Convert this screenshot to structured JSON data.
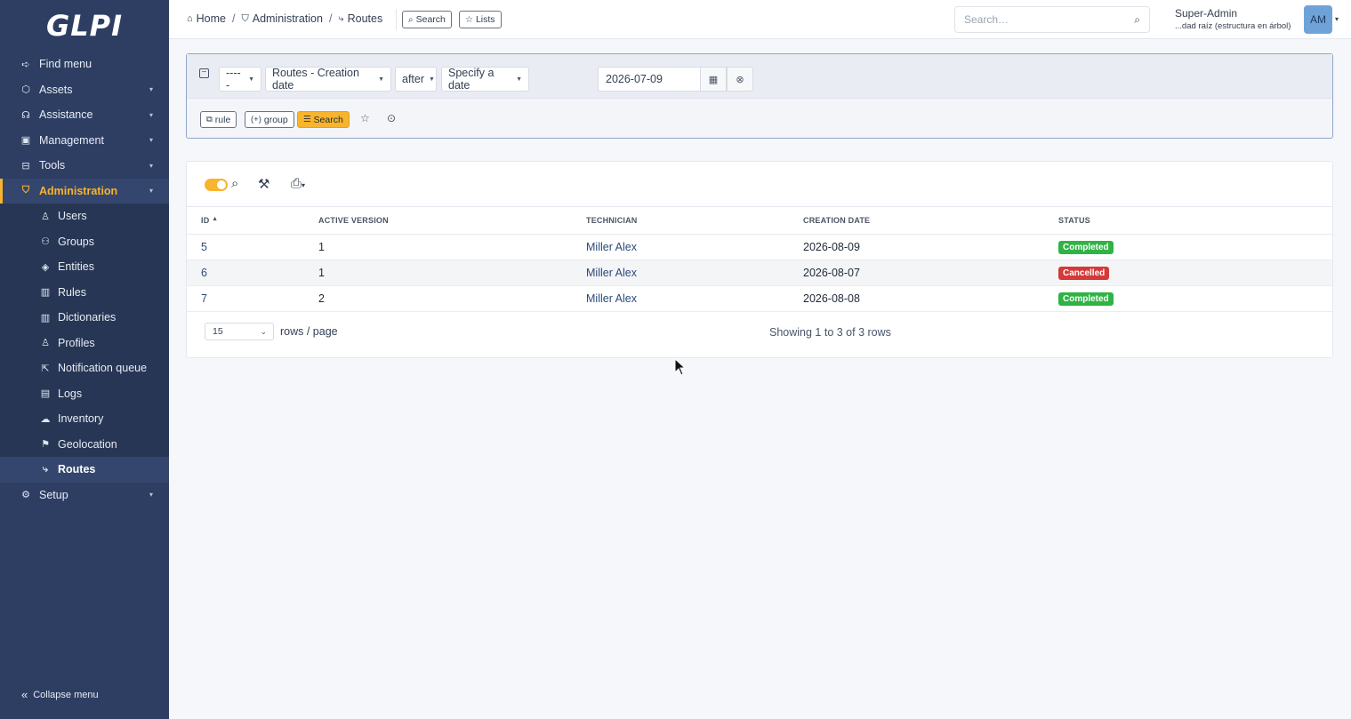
{
  "app": {
    "logo": "GLPI"
  },
  "sidebar": {
    "items": [
      {
        "label": "Find menu",
        "icon": "arrow-right-icon",
        "glyph": "➪",
        "chevron": false
      },
      {
        "label": "Assets",
        "icon": "box-icon",
        "glyph": "⬡",
        "chevron": true
      },
      {
        "label": "Assistance",
        "icon": "headset-icon",
        "glyph": "☊",
        "chevron": true
      },
      {
        "label": "Management",
        "icon": "wallet-icon",
        "glyph": "▣",
        "chevron": true
      },
      {
        "label": "Tools",
        "icon": "briefcase-icon",
        "glyph": "⊟",
        "chevron": true
      },
      {
        "label": "Administration",
        "icon": "shield-icon",
        "glyph": "⛉",
        "chevron": true,
        "active": true
      }
    ],
    "subitems": [
      {
        "label": "Users",
        "icon": "user-icon",
        "glyph": "♙"
      },
      {
        "label": "Groups",
        "icon": "users-icon",
        "glyph": "⚇"
      },
      {
        "label": "Entities",
        "icon": "layers-icon",
        "glyph": "◈"
      },
      {
        "label": "Rules",
        "icon": "book-icon",
        "glyph": "▥"
      },
      {
        "label": "Dictionaries",
        "icon": "book-icon",
        "glyph": "▥"
      },
      {
        "label": "Profiles",
        "icon": "user-check-icon",
        "glyph": "♙"
      },
      {
        "label": "Notification queue",
        "icon": "mail-forward-icon",
        "glyph": "⇱"
      },
      {
        "label": "Logs",
        "icon": "news-icon",
        "glyph": "▤"
      },
      {
        "label": "Inventory",
        "icon": "cloud-download-icon",
        "glyph": "☁"
      },
      {
        "label": "Geolocation",
        "icon": "map-route-icon",
        "glyph": "⚑"
      },
      {
        "label": "Routes",
        "icon": "route-icon",
        "glyph": "⤷",
        "current": true
      }
    ],
    "setup": {
      "label": "Setup",
      "icon": "gear-icon",
      "glyph": "⚙"
    },
    "collapse_label": "Collapse menu"
  },
  "header": {
    "breadcrumb": [
      {
        "label": "Home",
        "icon": "home-icon",
        "glyph": "⌂"
      },
      {
        "label": "Administration",
        "icon": "shield-icon",
        "glyph": "⛉"
      },
      {
        "label": "Routes",
        "icon": "route-icon",
        "glyph": "⤷"
      }
    ],
    "search_button": "Search",
    "lists_button": "Lists",
    "global_search_placeholder": "Search…",
    "user_name": "Super-Admin",
    "user_entity": "...dad raíz (estructura en árbol)",
    "avatar_initials": "AM"
  },
  "criteria": {
    "link_op": "-----",
    "field": "Routes - Creation date",
    "operator": "after",
    "value_type": "Specify a date",
    "date_value": "2026-07-09",
    "rule_button": "rule",
    "group_button": "group",
    "search_button": "Search"
  },
  "results": {
    "columns": [
      "ID",
      "ACTIVE VERSION",
      "TECHNICIAN",
      "CREATION DATE",
      "STATUS"
    ],
    "rows": [
      {
        "id": "5",
        "version": "1",
        "technician": "Miller Alex",
        "date": "2026-08-09",
        "status": "Completed",
        "status_color": "#2fb344"
      },
      {
        "id": "6",
        "version": "1",
        "technician": "Miller Alex",
        "date": "2026-08-07",
        "status": "Cancelled",
        "status_color": "#d63939"
      },
      {
        "id": "7",
        "version": "2",
        "technician": "Miller Alex",
        "date": "2026-08-08",
        "status": "Completed",
        "status_color": "#2fb344"
      }
    ],
    "rows_per_page": "15",
    "rows_per_page_label": "rows / page",
    "showing": "Showing 1 to 3 of 3 rows"
  },
  "colors": {
    "sidebar_bg": "#2e3e63",
    "accent": "#f7b42c",
    "link": "#2b4a7a"
  }
}
